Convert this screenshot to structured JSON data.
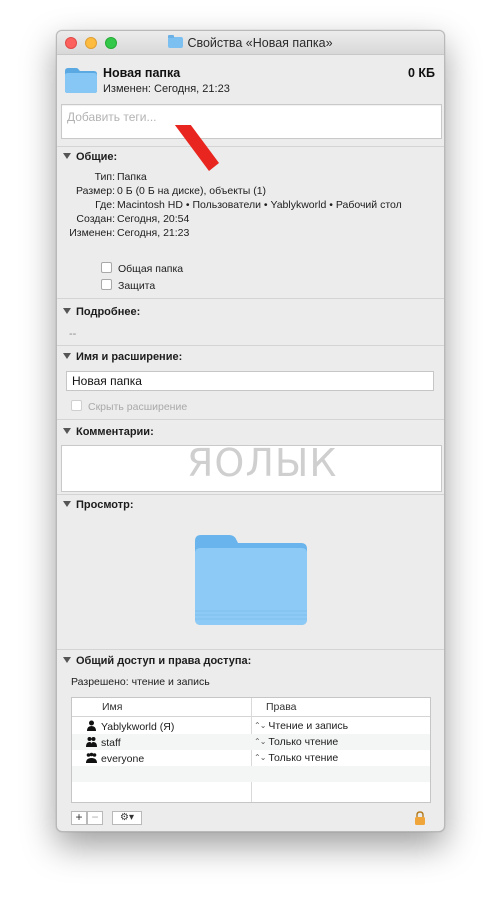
{
  "window": {
    "title": "Свойства «Новая папка»"
  },
  "header": {
    "name": "Новая папка",
    "size": "0 КБ",
    "modified": "Изменен: Сегодня, 21:23"
  },
  "tags": {
    "placeholder": "Добавить теги..."
  },
  "general": {
    "heading": "Общие:",
    "rows": [
      {
        "label": "Тип:",
        "value": "Папка"
      },
      {
        "label": "Размер:",
        "value": "0 Б (0 Б на диске), объекты (1)"
      },
      {
        "label": "Где:",
        "value": "Macintosh HD • Пользователи • Yablykworld • Рабочий стол"
      },
      {
        "label": "Создан:",
        "value": "Сегодня, 20:54"
      },
      {
        "label": "Изменен:",
        "value": "Сегодня, 21:23"
      }
    ],
    "shared_folder_label": "Общая папка",
    "locked_label": "Защита"
  },
  "more_info": {
    "heading": "Подробнее:",
    "value": "--"
  },
  "name_extension": {
    "heading": "Имя и расширение:",
    "name_value": "Новая папка",
    "hide_extension_label": "Скрыть расширение"
  },
  "comments": {
    "heading": "Комментарии:"
  },
  "watermark": "ЯОЛЫК",
  "preview": {
    "heading": "Просмотр:"
  },
  "sharing": {
    "heading": "Общий доступ и права доступа:",
    "summary": "Разрешено: чтение и запись",
    "columns": [
      "Имя",
      "Права"
    ],
    "rows": [
      {
        "user": "Yablykworld (Я)",
        "icon": "person-icon",
        "privilege": "Чтение и запись"
      },
      {
        "user": "staff",
        "icon": "group-icon",
        "privilege": "Только чтение"
      },
      {
        "user": "everyone",
        "icon": "everyone-icon",
        "privilege": "Только чтение"
      }
    ],
    "add_label": "+",
    "remove_label": "−",
    "gear_label": "⚙▾"
  },
  "colors": {
    "folder": "#7cc0f2",
    "arrow": "#e8261f",
    "close": "#fc615d",
    "minimize": "#fdbc40",
    "maximize": "#34c84a"
  }
}
